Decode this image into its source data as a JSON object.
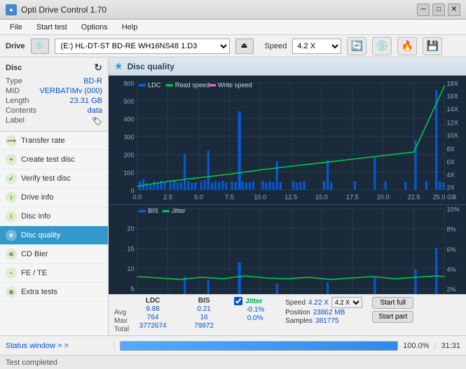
{
  "app": {
    "title": "Opti Drive Control 1.70",
    "icon": "disc"
  },
  "title_bar": {
    "minimize": "─",
    "maximize": "□",
    "close": "✕"
  },
  "menu": {
    "items": [
      "File",
      "Start test",
      "Options",
      "Help"
    ]
  },
  "drive_bar": {
    "drive_label": "Drive",
    "drive_value": "(E:) HL-DT-ST BD-RE  WH16NS48 1.D3",
    "speed_label": "Speed",
    "speed_value": "4.2 X",
    "eject_icon": "⏏"
  },
  "disc": {
    "header": "Disc",
    "refresh_icon": "↻",
    "rows": [
      {
        "label": "Type",
        "value": "BD-R"
      },
      {
        "label": "MID",
        "value": "VERBATIMv (000)"
      },
      {
        "label": "Length",
        "value": "23.31 GB"
      },
      {
        "label": "Contents",
        "value": "data"
      },
      {
        "label": "Label",
        "value": ""
      }
    ]
  },
  "nav": {
    "items": [
      {
        "label": "Transfer rate",
        "icon": "⟶",
        "active": false
      },
      {
        "label": "Create test disc",
        "icon": "+",
        "active": false
      },
      {
        "label": "Verify test disc",
        "icon": "✓",
        "active": false
      },
      {
        "label": "Drive info",
        "icon": "i",
        "active": false
      },
      {
        "label": "Disc info",
        "icon": "i",
        "active": false
      },
      {
        "label": "Disc quality",
        "icon": "★",
        "active": true
      },
      {
        "label": "CD Bier",
        "icon": "≋",
        "active": false
      },
      {
        "label": "FE / TE",
        "icon": "~",
        "active": false
      },
      {
        "label": "Extra tests",
        "icon": "⊕",
        "active": false
      }
    ]
  },
  "content": {
    "header": "Disc quality",
    "icon": "★",
    "chart1": {
      "legend": [
        "LDC",
        "Read speed",
        "Write speed"
      ],
      "y_max": 800,
      "x_max": 25,
      "right_axis_max": "18X"
    },
    "chart2": {
      "legend": [
        "BIS",
        "Jitter"
      ],
      "y_max": 20,
      "x_max": 25,
      "right_axis_max": "10%"
    }
  },
  "stats": {
    "columns": [
      "",
      "LDC",
      "BIS",
      "",
      "Jitter",
      "Speed",
      ""
    ],
    "rows": [
      {
        "label": "Avg",
        "ldc": "9.88",
        "bis": "0.21",
        "jitter": "-0.1%",
        "speed": "4.22 X"
      },
      {
        "label": "Max",
        "ldc": "764",
        "bis": "16",
        "jitter": "0.0%",
        "position": "23862 MB"
      },
      {
        "label": "Total",
        "ldc": "3772674",
        "bis": "79872",
        "jitter": "",
        "samples": "381775"
      }
    ],
    "speed_select": "4.2 X",
    "position_label": "Position",
    "samples_label": "Samples",
    "start_full_label": "Start full",
    "start_part_label": "Start part"
  },
  "status": {
    "window_label": "Status window > >",
    "completed_label": "Test completed",
    "progress": 100,
    "progress_text": "100.0%",
    "time": "31:31"
  }
}
